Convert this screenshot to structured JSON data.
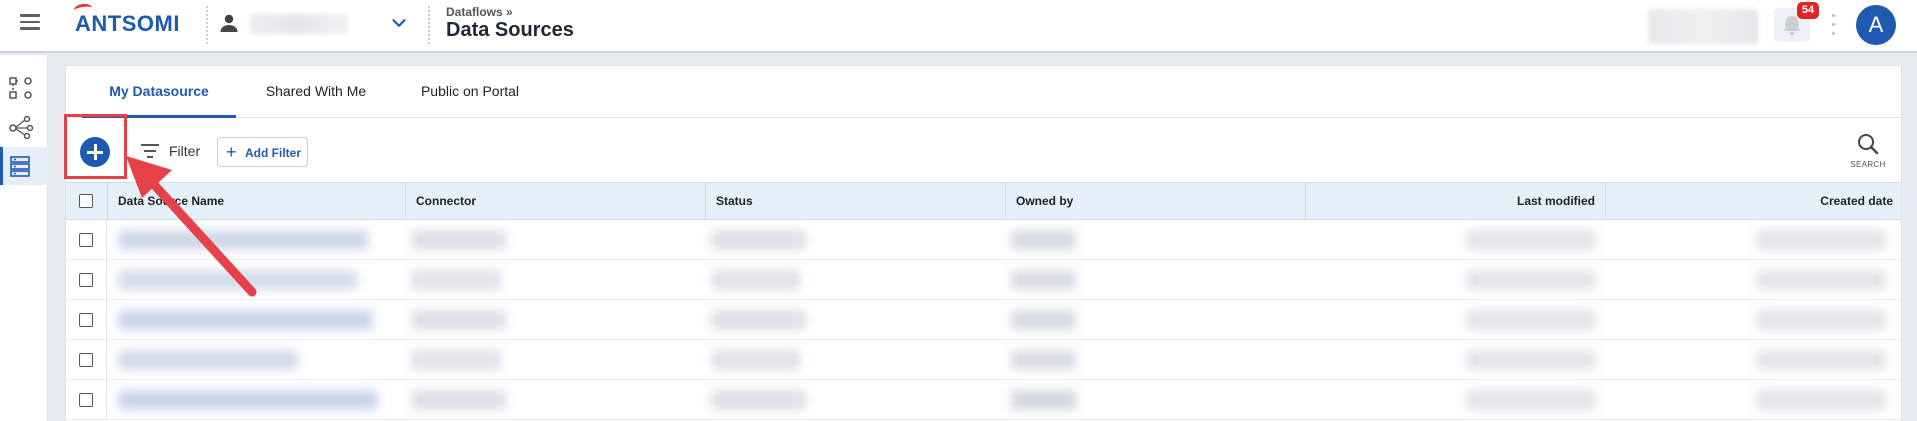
{
  "header": {
    "breadcrumb": "Dataflows »",
    "title": "Data Sources",
    "logo_text": "ANTSOMI",
    "notification_count": "54",
    "avatar_initial": "A"
  },
  "rail": {
    "items": [
      {
        "icon": "dataflow-icon"
      },
      {
        "icon": "share-network-icon"
      },
      {
        "icon": "data-sources-icon",
        "active": true
      }
    ]
  },
  "tabs": [
    {
      "label": "My Datasource",
      "active": true
    },
    {
      "label": "Shared With Me",
      "active": false
    },
    {
      "label": "Public on Portal",
      "active": false
    }
  ],
  "toolbar": {
    "filter_label": "Filter",
    "add_filter_label": "Add Filter",
    "add_filter_icon": "+",
    "search_label": "SEARCH"
  },
  "table": {
    "columns": [
      "Data Source Name",
      "Connector",
      "Status",
      "Owned by",
      "Last modified",
      "Created date"
    ],
    "row_count": 5
  },
  "colors": {
    "accent": "#1e5ab0",
    "annotation": "#e64048",
    "badge": "#e02424",
    "header_row": "#e6f0fa"
  }
}
